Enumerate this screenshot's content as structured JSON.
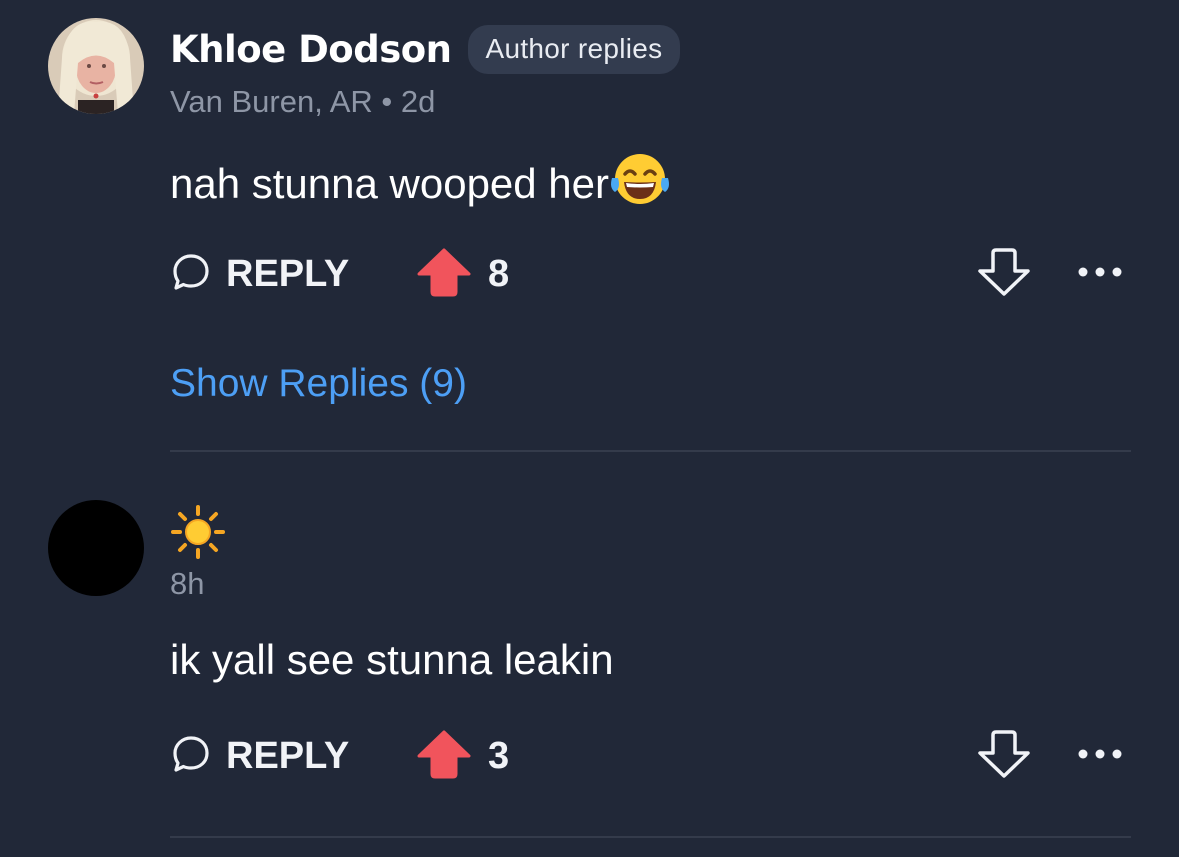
{
  "comments": [
    {
      "author": "Khloe Dodson",
      "badge": "Author replies",
      "location_time": "Van Buren, AR • 2d",
      "text": "nah stunna wooped her",
      "emoji": "face-with-tears-of-joy",
      "reply_label": "REPLY",
      "upvotes": "8",
      "show_replies": "Show Replies (9)"
    },
    {
      "author_emoji": "sun-icon",
      "time": "8h",
      "text": "ik yall see stunna leakin",
      "reply_label": "REPLY",
      "upvotes": "3"
    }
  ],
  "colors": {
    "background": "#212838",
    "upvote": "#f1545c",
    "link": "#4d9ff5",
    "muted": "#8e96a6",
    "divider": "#343b4b"
  }
}
